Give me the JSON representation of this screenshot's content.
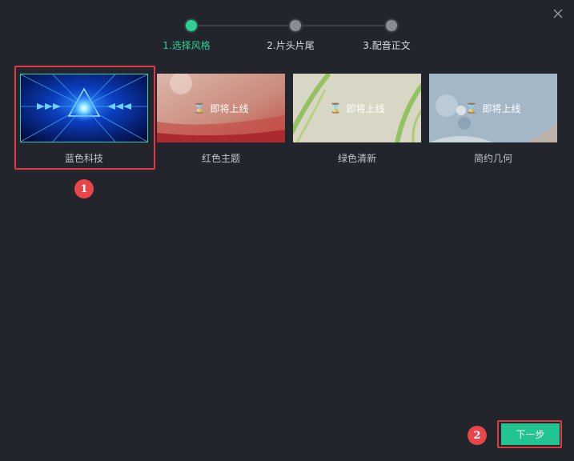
{
  "dialog": {
    "close_icon": "close-icon"
  },
  "steps": [
    {
      "label": "1.选择风格",
      "active": true
    },
    {
      "label": "2.片头片尾",
      "active": false
    },
    {
      "label": "3.配音正文",
      "active": false
    }
  ],
  "styles": [
    {
      "name": "蓝色科技",
      "selected": true,
      "overlay": ""
    },
    {
      "name": "红色主题",
      "selected": false,
      "overlay": "即将上线"
    },
    {
      "name": "绿色清新",
      "selected": false,
      "overlay": "即将上线"
    },
    {
      "name": "简约几何",
      "selected": false,
      "overlay": "即将上线"
    }
  ],
  "annotations": {
    "badge1": "1",
    "badge2": "2"
  },
  "footer": {
    "next_label": "下一步"
  },
  "colors": {
    "accent": "#2ed192",
    "button": "#22c491",
    "highlight": "#e0393f",
    "background": "#23252d"
  }
}
